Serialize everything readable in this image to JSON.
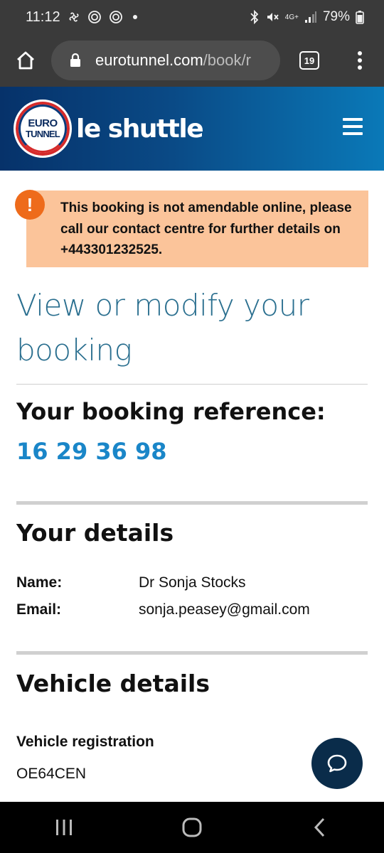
{
  "status_bar": {
    "time": "11:12",
    "battery": "79%",
    "network": "4G+",
    "icons": [
      "fan-icon",
      "ring-icon",
      "ring-icon",
      "dot-icon",
      "bluetooth-icon",
      "mute-icon",
      "signal-icon",
      "battery-icon"
    ]
  },
  "browser": {
    "url_domain": "eurotunnel.com",
    "url_path": "/book/r",
    "tab_count": "19"
  },
  "header": {
    "logo_line1": "EURO",
    "logo_line2": "TUNNEL",
    "brand": "le shuttle",
    "colors": {
      "gradient_start": "#06326a",
      "gradient_end": "#0a79b8"
    }
  },
  "alert": {
    "icon_text": "!",
    "message": "This booking is not amendable online, please call our contact centre for further details on +443301232525.",
    "colors": {
      "background": "#fbc49a",
      "icon": "#ee6b1b"
    }
  },
  "main": {
    "title": "View or modify your booking",
    "reference_label": "Your booking reference:",
    "reference_value": "16 29 36 98",
    "details": {
      "heading": "Your details",
      "name_label": "Name:",
      "name_value": "Dr Sonja Stocks",
      "email_label": "Email:",
      "email_value": "sonja.peasey@gmail.com"
    },
    "vehicle": {
      "heading": "Vehicle details",
      "registration_label": "Vehicle registration",
      "registration_value": "OE64CEN"
    }
  },
  "accent_colors": {
    "title": "#2a6f8f",
    "reference": "#1a86c8",
    "chat_button": "#0a2c4a"
  }
}
